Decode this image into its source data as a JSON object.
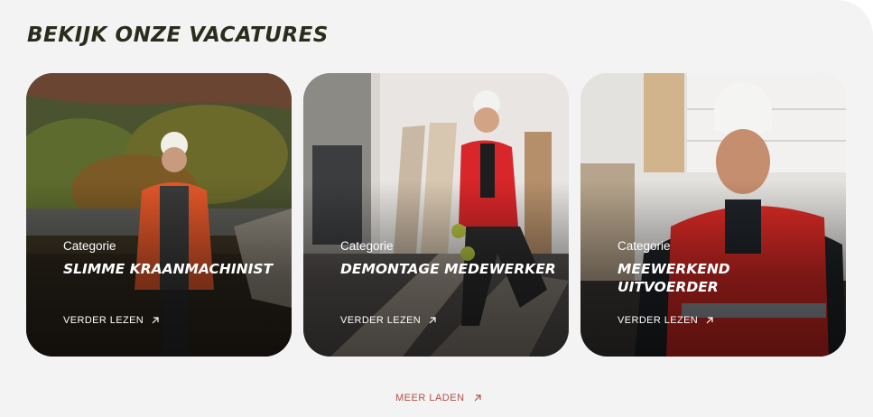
{
  "section": {
    "title": "BEKIJK ONZE VACATURES"
  },
  "cards": [
    {
      "category": "Categorie",
      "title": "SLIMME KRAANMACHINIST",
      "link": "VERDER LEZEN"
    },
    {
      "category": "Categorie",
      "title": "DEMONTAGE MEDEWERKER",
      "link": "VERDER LEZEN"
    },
    {
      "category": "Categorie",
      "title": "MEEWERKEND UITVOERDER",
      "link": "VERDER LEZEN"
    }
  ],
  "load_more": {
    "label": "MEER LADEN"
  },
  "icons": {
    "link_arrow": "arrow-up-right-icon"
  },
  "colors": {
    "background": "#f3f3f3",
    "title": "#2a2d1c",
    "accent": "#b0514a"
  }
}
